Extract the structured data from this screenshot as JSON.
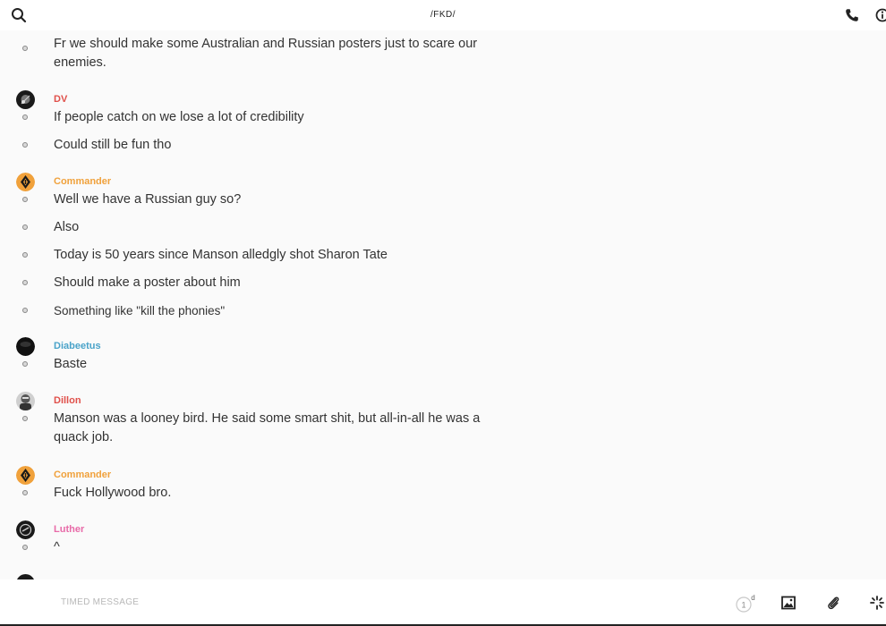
{
  "header": {
    "title": "/FKD/",
    "search_icon": "search-icon",
    "call_icon": "phone-icon",
    "info_icon": "info-icon"
  },
  "messages": [
    {
      "sender": "",
      "lines": [
        "Fr we should make some Australian and Russian posters just to scare our enemies."
      ]
    },
    {
      "sender": "DV",
      "sender_color": "#e0504a",
      "lines": [
        "If people catch on we lose a lot of credibility",
        "Could still be fun tho"
      ]
    },
    {
      "sender": "Commander",
      "sender_color": "#f0a13b",
      "lines": [
        "Well we have a Russian guy so?",
        "Also",
        "Today is 50 years since Manson alledgly shot Sharon Tate",
        "Should make a poster about him",
        "Something like \"kill the phonies\""
      ]
    },
    {
      "sender": "Diabeetus",
      "sender_color": "#4aa3c9",
      "lines": [
        "Baste"
      ]
    },
    {
      "sender": "Dillon",
      "sender_color": "#e0504a",
      "lines": [
        "Manson was a looney bird. He said some smart shit, but all-in-all he was a quack job."
      ]
    },
    {
      "sender": "Commander",
      "sender_color": "#f0a13b",
      "lines": [
        "Fuck Hollywood bro."
      ]
    },
    {
      "sender": "Luther",
      "sender_color": "#e86aa8",
      "lines": [
        "^"
      ]
    }
  ],
  "composer": {
    "placeholder": "TIMED MESSAGE",
    "timer_value": "1",
    "timer_unit": "d",
    "image_icon": "image-icon",
    "attach_icon": "paperclip-icon",
    "sticker_icon": "sparkle-icon"
  }
}
